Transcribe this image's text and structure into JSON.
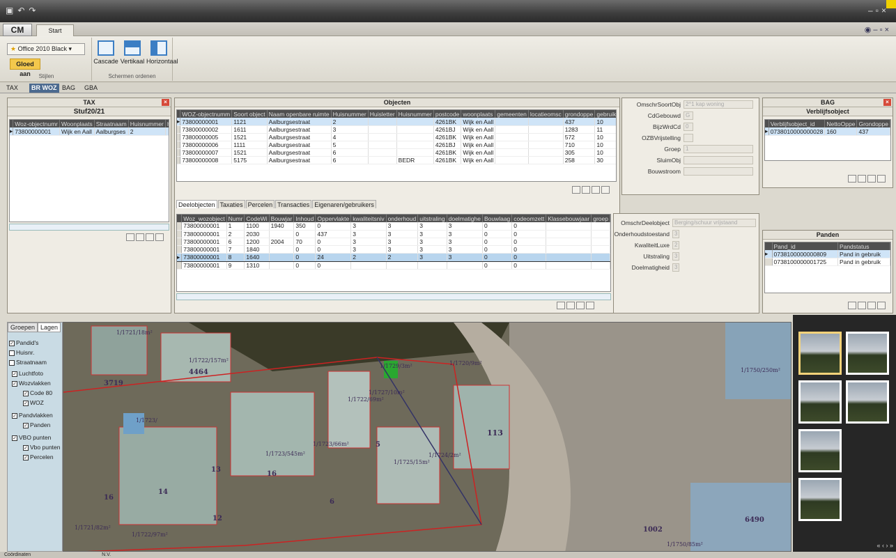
{
  "ribbon": {
    "tab": "Start",
    "app_button": "CM",
    "theme": "Office 2010 Black",
    "gloed_label": "Gloed aan",
    "stijlen_caption": "Stijlen",
    "layout_caption": "Schermen ordenen",
    "layouts": [
      "Cascade",
      "Vertikaal",
      "Horizontaal"
    ]
  },
  "modules": [
    "TAX",
    "BR WOZ",
    "BAG",
    "GBA"
  ],
  "tax": {
    "title": "TAX",
    "subtitle": "Stuf20/21",
    "columns": [
      "Woz-objectnumr",
      "Woonplaats",
      "Straatnaam",
      "Huisnummer",
      "Hu"
    ],
    "row": [
      "73800000001",
      "Wijk en Aall",
      "Aalburgses",
      "2"
    ]
  },
  "objecten": {
    "title": "Objecten",
    "columns": [
      "WOZ-objectnumm",
      "Soort object",
      "Naam openbare ruimte",
      "Huisnummer",
      "Huisletter",
      "Huisnummer",
      "postcode",
      "woonplaats",
      "gemeenten",
      "locatieomsc",
      "grondoppe",
      "gebruiksdoe"
    ],
    "rows": [
      [
        "73800000001",
        "1121",
        "Aalburgsestraat",
        "2",
        "",
        "",
        "4261BK",
        "Wijk en Aall",
        "",
        "",
        "437",
        "10"
      ],
      [
        "73800000002",
        "1611",
        "Aalburgsestraat",
        "3",
        "",
        "",
        "4261BJ",
        "Wijk en Aall",
        "",
        "",
        "1283",
        "11"
      ],
      [
        "73800000005",
        "1521",
        "Aalburgsestraat",
        "4",
        "",
        "",
        "4261BK",
        "Wijk en Aall",
        "",
        "",
        "572",
        "10"
      ],
      [
        "73800000006",
        "1111",
        "Aalburgsestraat",
        "5",
        "",
        "",
        "4261BJ",
        "Wijk en Aall",
        "",
        "",
        "710",
        "10"
      ],
      [
        "73800000007",
        "1521",
        "Aalburgsestraat",
        "6",
        "",
        "",
        "4261BK",
        "Wijk en Aall",
        "",
        "",
        "305",
        "10"
      ],
      [
        "73800000008",
        "5175",
        "Aalburgsestraat",
        "6",
        "",
        "BEDR",
        "4261BK",
        "Wijk en Aall",
        "",
        "",
        "258",
        "30"
      ]
    ]
  },
  "objform": {
    "fields": [
      {
        "label": "OmschrSoortObj",
        "value": "2^1 kap woning"
      },
      {
        "label": "CdGebouwd",
        "value": "G"
      },
      {
        "label": "BijzWrdCd",
        "value": "0"
      },
      {
        "label": "OZBVrijstelling",
        "value": ""
      },
      {
        "label": "Groep",
        "value": "1"
      },
      {
        "label": "SluimObj",
        "value": ""
      },
      {
        "label": "Bouwstroom",
        "value": ""
      }
    ]
  },
  "subtabs": [
    "Deelobjecten",
    "Taxaties",
    "Percelen",
    "Transacties",
    "Eigenaren/gebruikers"
  ],
  "deel": {
    "columns": [
      "Woz_wozobject",
      "Numr",
      "CodeWi",
      "Bouwjar",
      "Inhoud",
      "Oppervlakte",
      "kwaliteitsniv",
      "onderhoud",
      "uitstraling",
      "doelmatighe",
      "Bouwlaag",
      "codeomzett",
      "Klassebouwjaar",
      "groep"
    ],
    "rows": [
      [
        "73800000001",
        "1",
        "1100",
        "1940",
        "350",
        "0",
        "3",
        "3",
        "3",
        "3",
        "0",
        "0",
        "",
        ""
      ],
      [
        "73800000001",
        "2",
        "2030",
        "",
        "0",
        "437",
        "3",
        "3",
        "3",
        "3",
        "0",
        "0",
        "",
        ""
      ],
      [
        "73800000001",
        "6",
        "1200",
        "2004",
        "70",
        "0",
        "3",
        "3",
        "3",
        "3",
        "0",
        "0",
        "",
        ""
      ],
      [
        "73800000001",
        "7",
        "1840",
        "",
        "0",
        "0",
        "3",
        "3",
        "3",
        "3",
        "0",
        "0",
        "",
        ""
      ],
      [
        "73800000001",
        "8",
        "1640",
        "",
        "0",
        "24",
        "2",
        "2",
        "3",
        "3",
        "0",
        "0",
        "",
        ""
      ],
      [
        "73800000001",
        "9",
        "1310",
        "",
        "0",
        "0",
        "",
        "",
        "",
        "",
        "0",
        "0",
        "",
        ""
      ]
    ]
  },
  "deelform": {
    "fields": [
      {
        "label": "OmschrDeelobject",
        "value": "Berging/schuur vrijstaand"
      },
      {
        "label": "Onderhoudstoestand",
        "value": "3"
      },
      {
        "label": "KwaliteitLuxe",
        "value": "2"
      },
      {
        "label": "Uitstraling",
        "value": "3"
      },
      {
        "label": "Doelmatigheid",
        "value": "3"
      }
    ]
  },
  "bag": {
    "title": "BAG",
    "subtitle": "Verblijfsobject",
    "columns": [
      "Verblijfsobject_id",
      "NettoOppe",
      "Grondoppe"
    ],
    "row": [
      "0738010000000028",
      "160",
      "437"
    ]
  },
  "panden": {
    "title": "Panden",
    "columns": [
      "Pand_id",
      "Pandstatus"
    ],
    "rows": [
      [
        "0738100000000809",
        "Pand in gebruik"
      ],
      [
        "0738100000001725",
        "Pand in gebruik"
      ]
    ]
  },
  "layers": {
    "tabs": [
      "Groepen",
      "Lagen"
    ],
    "items": [
      "Pandid's",
      "Huisnr.",
      "Straatnaam",
      "Luchtfoto",
      "Wozvlakken",
      "Code 80",
      "WOZ",
      "Pandvlakken",
      "Panden",
      "VBO punten",
      "Vbo punten",
      "Percelen"
    ]
  },
  "map": {
    "labels": [
      "1/1721/18m²",
      "1/1722/157m²",
      "4464",
      "3719",
      "1/1723/",
      "1/1723/66m²",
      "1/1723/545m²",
      "13",
      "16",
      "14",
      "16",
      "1/1721/82m²",
      "1/1722/97m²",
      "12",
      "1/1729/3m²",
      "1/1722/69m²",
      "1/1720/9m²",
      "5",
      "113",
      "1/1725/15m²",
      "1/1724/2m²",
      "1002",
      "6490",
      "1/1750/250m²",
      "1/1750/85m²",
      "6",
      "1/1727/10m²"
    ]
  },
  "status": {
    "left": "Coördinaten",
    "mid": "N.V."
  }
}
